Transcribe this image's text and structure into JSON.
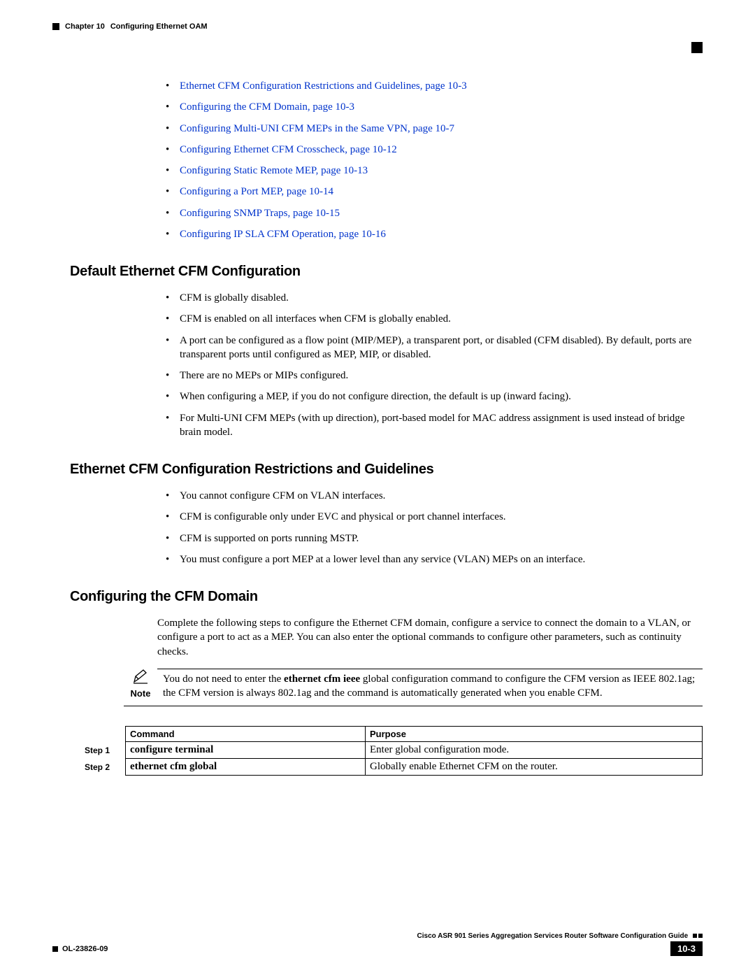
{
  "header": {
    "chapter": "Chapter 10",
    "title": "Configuring Ethernet OAM"
  },
  "links": [
    "Ethernet CFM Configuration Restrictions and Guidelines, page 10-3",
    "Configuring the CFM Domain, page 10-3",
    "Configuring Multi-UNI CFM MEPs in the Same VPN, page 10-7",
    "Configuring Ethernet CFM Crosscheck, page 10-12",
    "Configuring Static Remote MEP, page 10-13",
    "Configuring a Port MEP, page 10-14",
    "Configuring SNMP Traps, page 10-15",
    "Configuring IP SLA CFM Operation, page 10-16"
  ],
  "section1": {
    "title": "Default Ethernet CFM Configuration",
    "bullets": [
      "CFM is globally disabled.",
      "CFM is enabled on all interfaces when CFM is globally enabled.",
      "A port can be configured as a flow point (MIP/MEP), a transparent port, or disabled (CFM disabled). By default, ports are transparent ports until configured as MEP, MIP, or disabled.",
      "There are no MEPs or MIPs configured.",
      "When configuring a MEP, if you do not configure direction, the default is up (inward facing).",
      "For Multi-UNI CFM MEPs (with up direction), port-based model for MAC address assignment is used instead of bridge brain model."
    ]
  },
  "section2": {
    "title": "Ethernet CFM Configuration Restrictions and Guidelines",
    "bullets": [
      "You cannot configure CFM on VLAN interfaces.",
      "CFM is configurable only under EVC and physical or port channel interfaces.",
      "CFM is supported on ports running MSTP.",
      "You must configure a port MEP at a lower level than any service (VLAN) MEPs on an interface."
    ]
  },
  "section3": {
    "title": "Configuring the CFM Domain",
    "intro": "Complete the following steps to configure the Ethernet CFM domain, configure a service to connect the domain to a VLAN, or configure a port to act as a MEP. You can also enter the optional commands to configure other parameters, such as continuity checks.",
    "note_label": "Note",
    "note_pre": "You do not need to enter the ",
    "note_bold": "ethernet cfm ieee",
    "note_post": " global configuration command to configure the CFM version as IEEE 802.1ag; the CFM version is always 802.1ag and the command is automatically generated when you enable CFM."
  },
  "table": {
    "h1": "Command",
    "h2": "Purpose",
    "rows": [
      {
        "step": "Step 1",
        "cmd": "configure terminal",
        "purpose": "Enter global configuration mode."
      },
      {
        "step": "Step 2",
        "cmd": "ethernet cfm global",
        "purpose": "Globally enable Ethernet CFM on the router."
      }
    ]
  },
  "footer": {
    "guide": "Cisco ASR 901 Series Aggregation Services Router Software Configuration Guide",
    "ol": "OL-23826-09",
    "page": "10-3"
  }
}
